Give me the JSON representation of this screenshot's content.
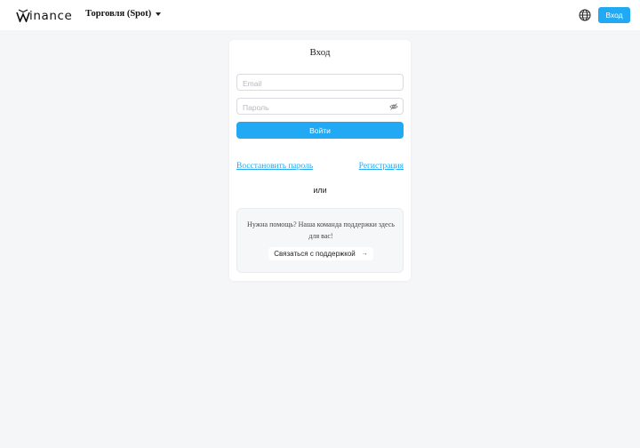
{
  "brand": {
    "logo_text": "inance",
    "accent": "#21a9f3"
  },
  "header": {
    "menu_label": "Торговля (Spot)",
    "language_icon": "globe-icon",
    "login_label": "Вход"
  },
  "login": {
    "title": "Вход",
    "email_placeholder": "Email",
    "password_placeholder": "Пароль",
    "password_toggle_icon": "eye-slash-icon",
    "submit_label": "Войти",
    "forgot_label": "Восстановить пароль",
    "register_label": "Регистрация",
    "or_label": "или"
  },
  "support": {
    "text": "Нужна помощь? Наша команда поддержки здесь для вас!",
    "button_label": "Связаться с поддержкой",
    "arrow": "→"
  }
}
